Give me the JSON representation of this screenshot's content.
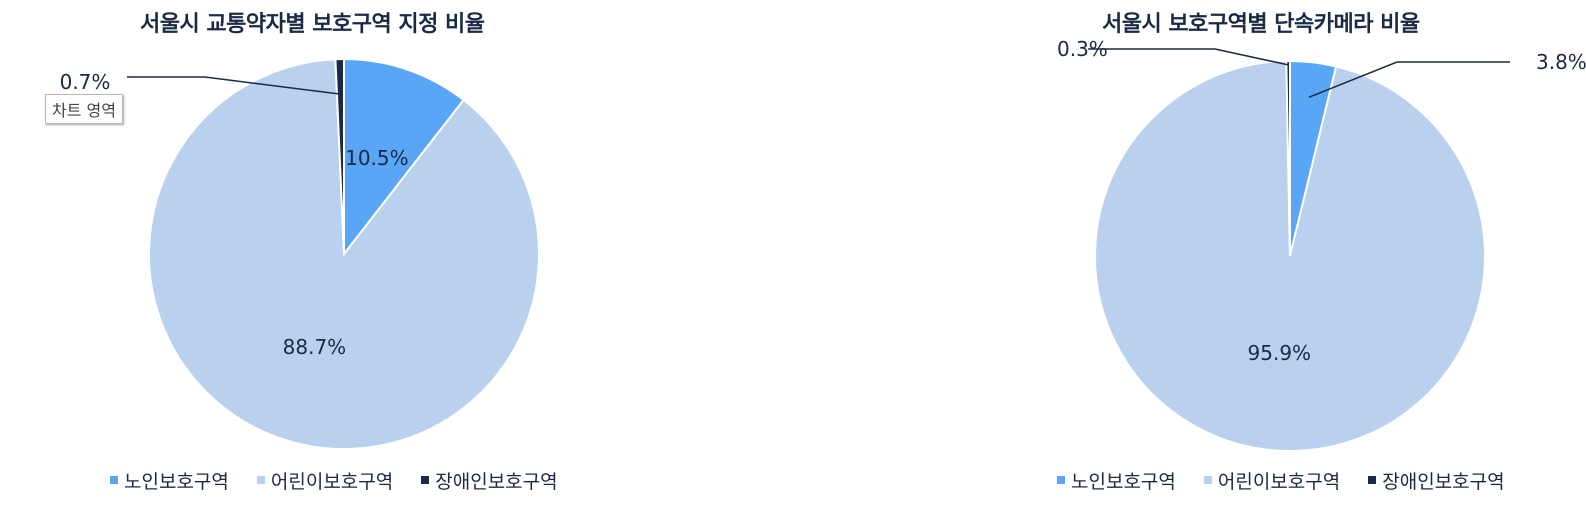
{
  "colors": {
    "elderly": "#59a6f7",
    "child": "#b9d0ee",
    "disabled": "#1b2a44",
    "title": "#1b2a44"
  },
  "tooltip": "차트 영역",
  "chart_data": [
    {
      "type": "pie",
      "title": "서울시 교통약자별 보호구역 지정 비율",
      "categories": [
        "노인보호구역",
        "어린이보호구역",
        "장애인보호구역"
      ],
      "values": [
        10.5,
        88.7,
        0.7
      ],
      "labels": [
        "10.5%",
        "88.7%",
        "0.7%"
      ],
      "legend": "bottom"
    },
    {
      "type": "pie",
      "title": "서울시 보호구역별 단속카메라 비율",
      "categories": [
        "노인보호구역",
        "어린이보호구역",
        "장애인보호구역"
      ],
      "values": [
        3.8,
        95.9,
        0.3
      ],
      "labels": [
        "3.8%",
        "95.9%",
        "0.3%"
      ],
      "legend": "bottom"
    }
  ]
}
